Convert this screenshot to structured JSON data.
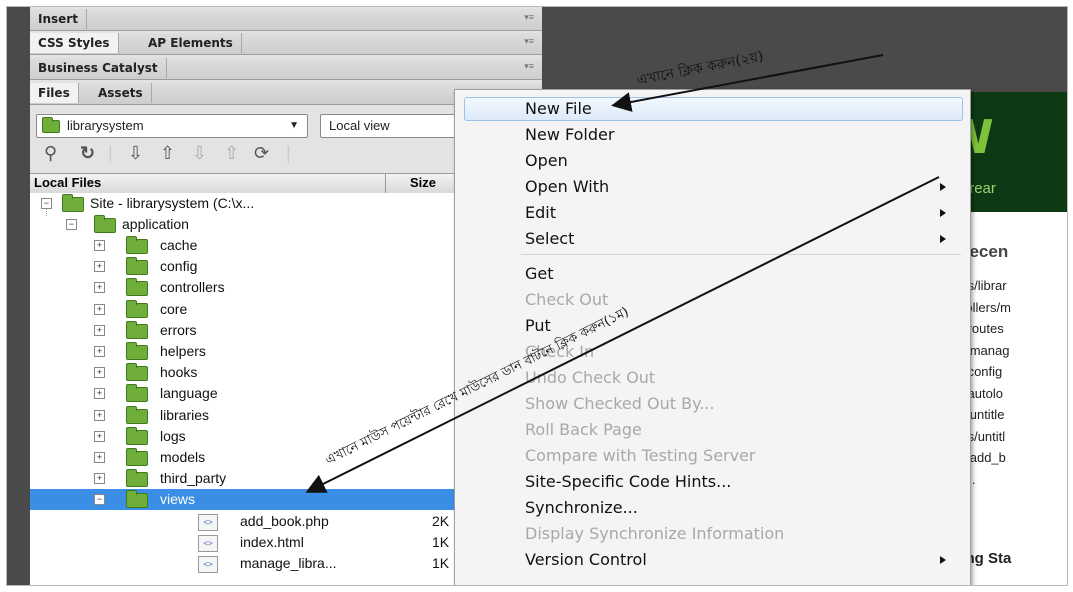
{
  "panels": {
    "insert_label": "Insert",
    "css_styles_label": "CSS Styles",
    "ap_elements_label": "AP Elements",
    "business_catalyst_label": "Business Catalyst",
    "files_label": "Files",
    "assets_label": "Assets"
  },
  "files_panel": {
    "site_dropdown": "librarysystem",
    "view_dropdown": "Local view",
    "header_local_files": "Local Files",
    "header_size": "Size",
    "site_root": "Site - librarysystem (C:\\x...",
    "application": "application",
    "folders": [
      "cache",
      "config",
      "controllers",
      "core",
      "errors",
      "helpers",
      "hooks",
      "language",
      "libraries",
      "logs",
      "models",
      "third_party",
      "views"
    ],
    "files": [
      {
        "name": "add_book.php",
        "size": "2K"
      },
      {
        "name": "index.html",
        "size": "1K"
      },
      {
        "name": "manage_libra...",
        "size": "1K"
      }
    ]
  },
  "welcome": {
    "logo_letter": "W",
    "subtitle": "e' Drear",
    "recent_heading": "a Recen",
    "recent_items": [
      "odels/librar",
      "ontrollers/m",
      "nfig/routes",
      "ews/manag",
      "nfig/config",
      "nfig/autolo",
      "ews/untitle",
      "odels/untitl",
      "ews/add_b",
      "pen..."
    ],
    "getting_started": "etting Sta"
  },
  "context_menu": {
    "items": [
      {
        "label": "New File",
        "state": "highlight"
      },
      {
        "label": "New Folder",
        "state": "normal"
      },
      {
        "label": "Open",
        "state": "normal"
      },
      {
        "label": "Open With",
        "state": "submenu"
      },
      {
        "label": "Edit",
        "state": "submenu"
      },
      {
        "label": "Select",
        "state": "submenu"
      },
      {
        "label": "Get",
        "state": "normal"
      },
      {
        "label": "Check Out",
        "state": "disabled"
      },
      {
        "label": "Put",
        "state": "normal"
      },
      {
        "label": "Check In",
        "state": "disabled"
      },
      {
        "label": "Undo Check Out",
        "state": "disabled"
      },
      {
        "label": "Show Checked Out By...",
        "state": "disabled"
      },
      {
        "label": "Roll Back Page",
        "state": "disabled"
      },
      {
        "label": "Compare with Testing Server",
        "state": "disabled"
      },
      {
        "label": "Site-Specific Code Hints...",
        "state": "normal"
      },
      {
        "label": "Synchronize...",
        "state": "normal"
      },
      {
        "label": "Display Synchronize Information",
        "state": "disabled"
      },
      {
        "label": "Version Control",
        "state": "submenu"
      }
    ]
  },
  "annotations": {
    "second": "এখানে ক্লিক করুন(২য়)",
    "first_a": "এখানে মাউস পয়েন্টার রেখে মাউসের ডান বাটনে ক্লিক করুন(১ম)"
  },
  "colors": {
    "selection": "#3a8ee6",
    "folder": "#6fae3a",
    "banner": "#0d3a14",
    "logo": "#7ec23a"
  }
}
